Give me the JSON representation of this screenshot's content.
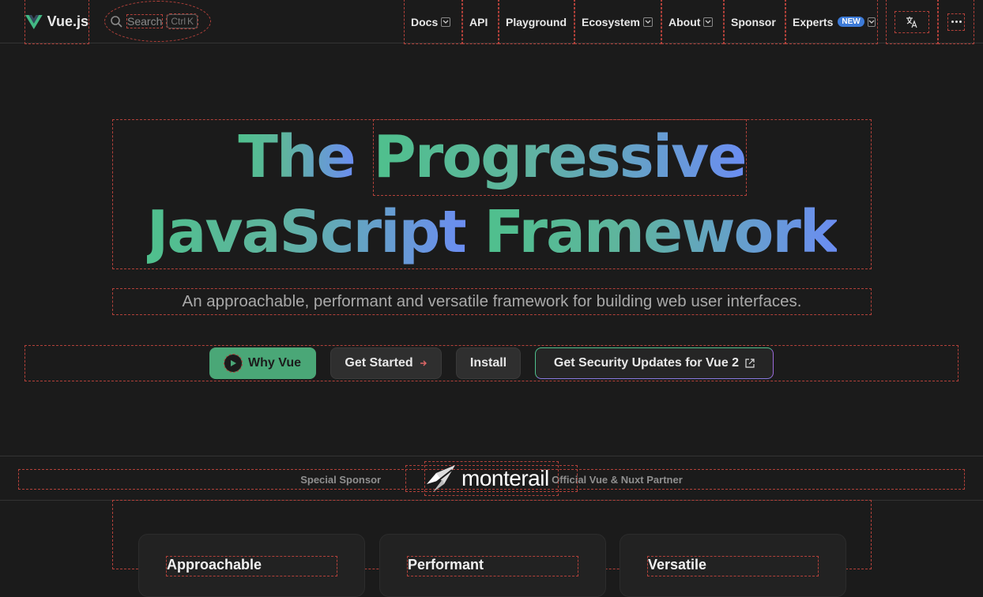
{
  "brand": {
    "name": "Vue.js",
    "logo_color": "#42b883"
  },
  "search": {
    "label": "Search",
    "kbd_ctrl": "Ctrl",
    "kbd_key": "K"
  },
  "nav": {
    "docs": "Docs",
    "api": "API",
    "playground": "Playground",
    "ecosystem": "Ecosystem",
    "about": "About",
    "sponsor": "Sponsor",
    "experts": "Experts",
    "experts_badge": "NEW"
  },
  "hero": {
    "title_line1_a": "The",
    "title_line1_b": "Progressive",
    "title_line2_a": "JavaScript",
    "title_line2_b": "Framework",
    "subtitle": "An approachable, performant and versatile framework for building web user interfaces."
  },
  "actions": {
    "why_vue": "Why Vue",
    "get_started": "Get Started",
    "install": "Install",
    "security": "Get Security Updates for Vue 2"
  },
  "sponsor": {
    "left": "Special Sponsor",
    "right": "Official Vue & Nuxt Partner",
    "logo_text": "monterail"
  },
  "features": [
    {
      "title": "Approachable"
    },
    {
      "title": "Performant"
    },
    {
      "title": "Versatile"
    }
  ],
  "colors": {
    "accent": "#42b883",
    "gradient_end": "#6b8df2",
    "background": "#1b1b1b"
  }
}
